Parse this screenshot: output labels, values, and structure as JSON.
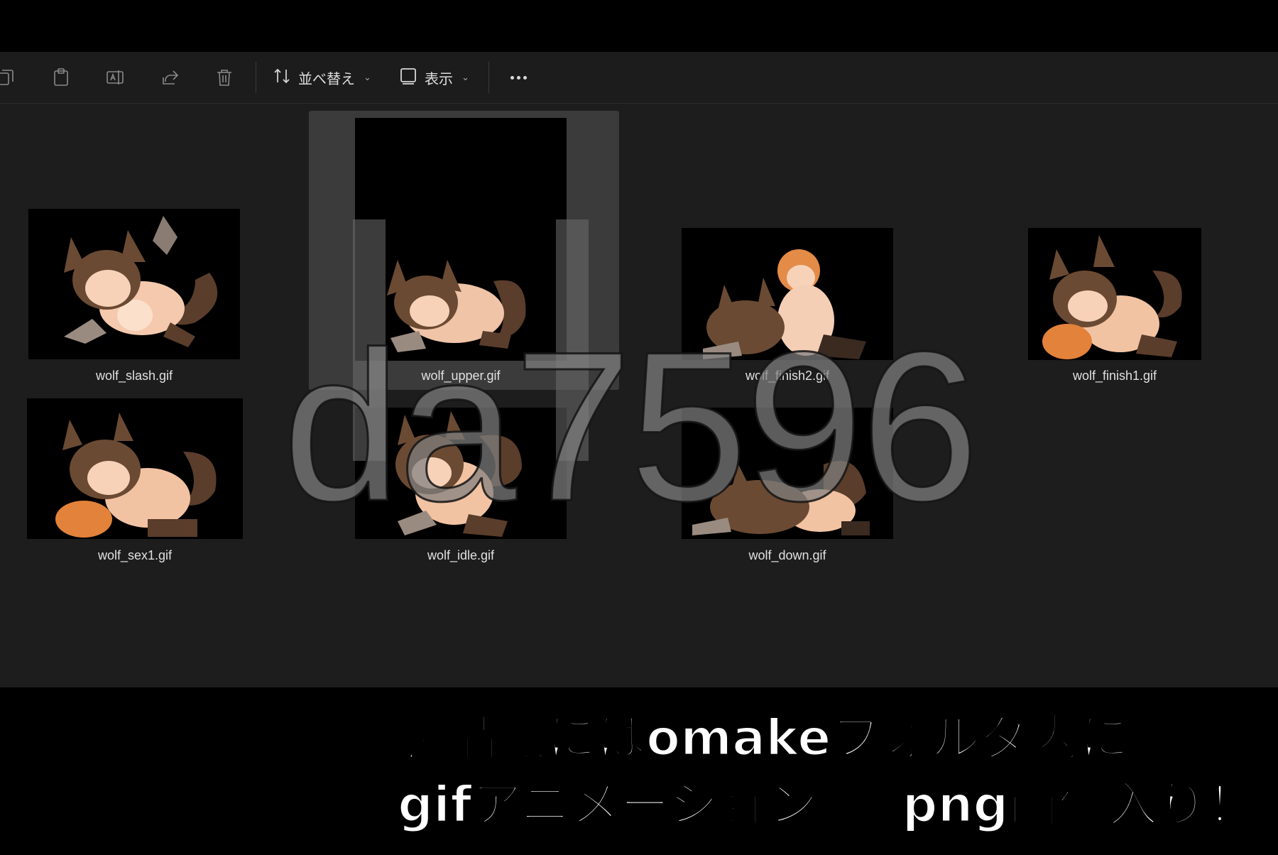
{
  "toolbar": {
    "sort_label": "並べ替え",
    "view_label": "表示",
    "more_label": "…"
  },
  "files": [
    {
      "name": "wolf_slash.gif"
    },
    {
      "name": "wolf_upper.gif"
    },
    {
      "name": "wolf_finish2.gif"
    },
    {
      "name": "wolf_finish1.gif"
    },
    {
      "name": "wolf_sex1.gif"
    },
    {
      "name": "wolf_idle.gif"
    },
    {
      "name": "wolf_down.gif"
    }
  ],
  "selected_file": "wolf_upper.gif",
  "watermark": "da7596",
  "caption": {
    "line1": "製品版にはomakeフォルダ内に",
    "line2": "gifアニメーション ＋ png画像入り！"
  },
  "colors": {
    "background": "#1d1d1d",
    "toolbar": "#1c1c1c",
    "selection": "#3b3b3b",
    "hair": "#6b4a33",
    "skin": "#f2c3a3"
  },
  "icons": [
    "copy-icon",
    "paste-icon",
    "rename-icon",
    "share-icon",
    "delete-icon",
    "sort-icon",
    "view-icon",
    "more-icon"
  ]
}
